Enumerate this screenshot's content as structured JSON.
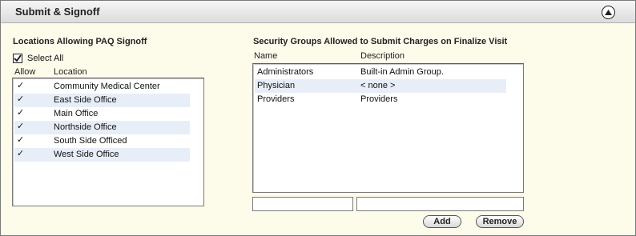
{
  "header": {
    "title": "Submit & Signoff",
    "collapse_icon": "chevron-up-icon"
  },
  "locations": {
    "title": "Locations Allowing PAQ Signoff",
    "select_all_label": "Select All",
    "select_all_checked": true,
    "columns": {
      "allow": "Allow",
      "location": "Location"
    },
    "rows": [
      {
        "allow": "✓",
        "name": "Community Medical Center"
      },
      {
        "allow": "✓",
        "name": "East Side Office"
      },
      {
        "allow": "✓",
        "name": "Main Office"
      },
      {
        "allow": "✓",
        "name": "Northside Office"
      },
      {
        "allow": "✓",
        "name": "South Side Officed"
      },
      {
        "allow": "✓",
        "name": "West Side Office"
      }
    ]
  },
  "security_groups": {
    "title": "Security Groups Allowed to Submit Charges on Finalize Visit",
    "columns": {
      "name": "Name",
      "description": "Description"
    },
    "rows": [
      {
        "name": "Administrators",
        "description": "Built-in Admin Group."
      },
      {
        "name": "Physician",
        "description": "< none >"
      },
      {
        "name": "Providers",
        "description": "Providers"
      }
    ],
    "name_input": {
      "value": "",
      "placeholder": ""
    },
    "description_input": {
      "value": "",
      "placeholder": ""
    },
    "add_label": "Add",
    "remove_label": "Remove"
  },
  "colors": {
    "header_bg": "#dcdcdc",
    "panel_bg": "#fdfbea",
    "row_alt": "#e8eef8"
  }
}
